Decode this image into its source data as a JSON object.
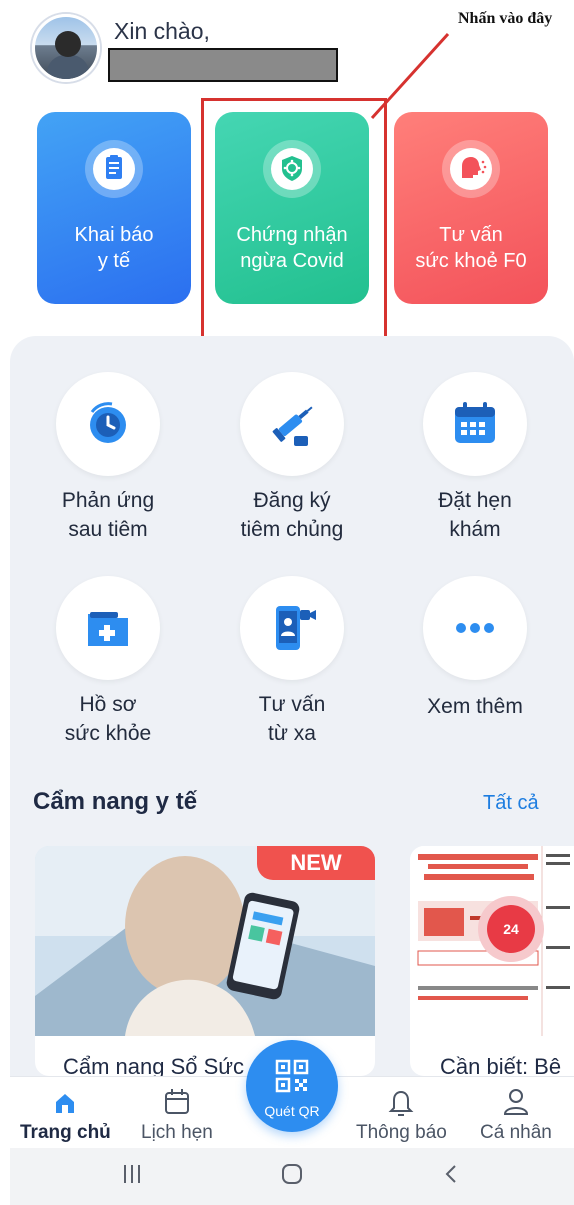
{
  "header": {
    "greeting": "Xin chào,",
    "annotation": "Nhấn vào đây"
  },
  "cards": [
    {
      "label_line1": "Khai báo",
      "label_line2": "y tế",
      "icon": "clipboard-medical-icon",
      "color": "#2f7ff2"
    },
    {
      "label_line1": "Chứng nhận",
      "label_line2": "ngừa Covid",
      "icon": "virus-shield-icon",
      "color": "#2cc79a"
    },
    {
      "label_line1": "Tư vấn",
      "label_line2": "sức khoẻ F0",
      "icon": "cough-head-icon",
      "color": "#f5605f"
    }
  ],
  "services": [
    {
      "line1": "Phản ứng",
      "line2": "sau tiêm",
      "icon": "clock-reaction-icon"
    },
    {
      "line1": "Đăng ký",
      "line2": "tiêm chủng",
      "icon": "syringe-icon"
    },
    {
      "line1": "Đặt hẹn",
      "line2": "khám",
      "icon": "calendar-icon"
    },
    {
      "line1": "Hồ sơ",
      "line2": "sức khỏe",
      "icon": "medical-folder-icon"
    },
    {
      "line1": "Tư vấn",
      "line2": "từ xa",
      "icon": "video-doctor-icon"
    },
    {
      "line1": "Xem thêm",
      "line2": "",
      "icon": "more-dots-icon"
    }
  ],
  "handbook": {
    "title": "Cẩm nang y tế",
    "see_all": "Tất cả",
    "articles": [
      {
        "title": "Cẩm nang Sổ Sức",
        "badge": "NEW"
      },
      {
        "title": "Cần biết: Bê"
      }
    ]
  },
  "emergency": {
    "label": "24"
  },
  "nav": {
    "home": "Trang chủ",
    "schedule": "Lịch hẹn",
    "qr": "Quét QR",
    "notifications": "Thông báo",
    "profile": "Cá nhân"
  },
  "colors": {
    "accent": "#2d8df0",
    "annotation_red": "#d6322f",
    "panel_bg": "#eef1f6"
  }
}
